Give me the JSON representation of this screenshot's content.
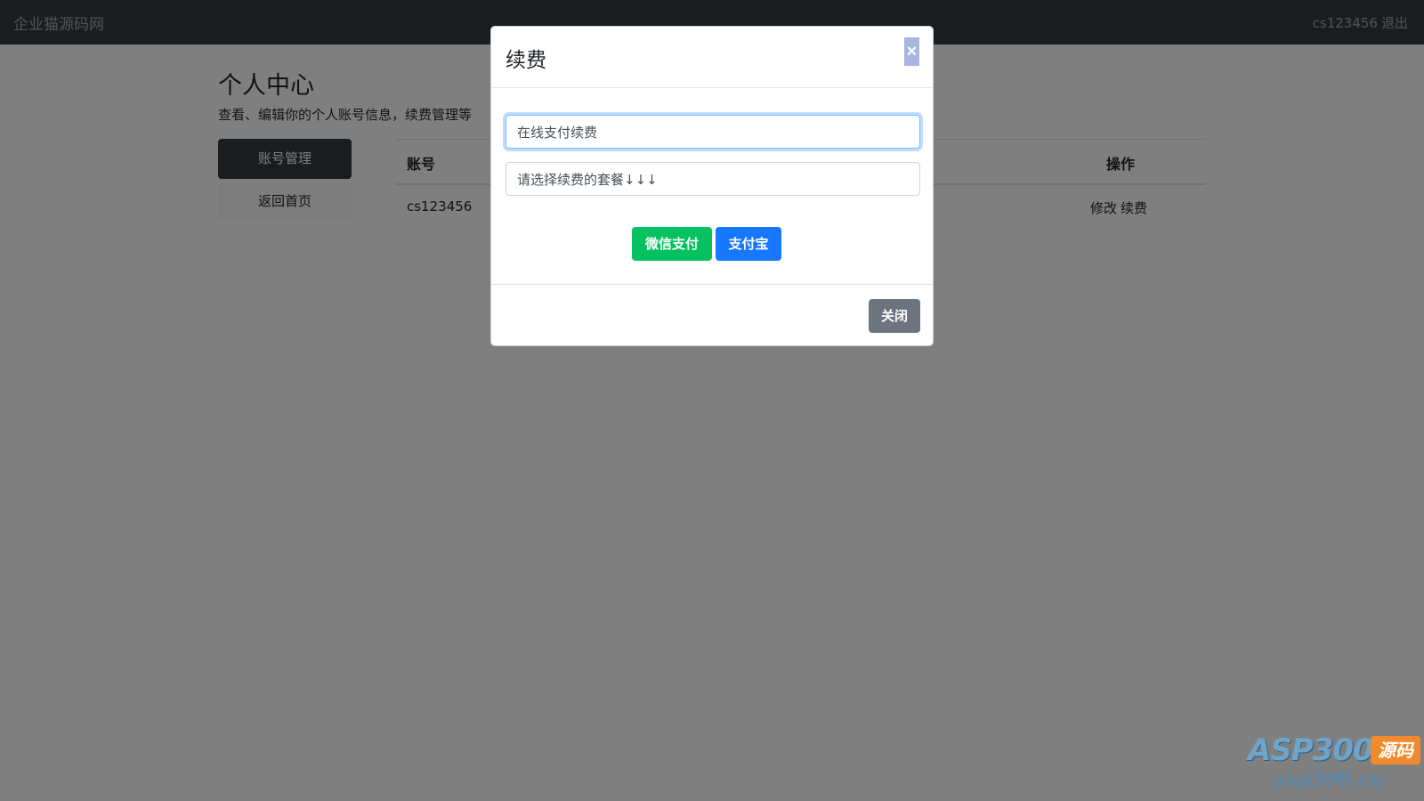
{
  "navbar": {
    "brand": "企业猫源码网",
    "username": "cs123456",
    "logout_label": "退出"
  },
  "page": {
    "title": "个人中心",
    "subtitle": "查看、编辑你的个人账号信息，续费管理等",
    "sidebar": [
      {
        "label": "账号管理",
        "active": true
      },
      {
        "label": "返回首页",
        "active": false
      }
    ],
    "table": {
      "headers": {
        "account": "账号",
        "actions": "操作"
      },
      "rows": [
        {
          "account": "cs123456",
          "edit_label": "修改",
          "renew_label": "续费"
        }
      ]
    }
  },
  "modal": {
    "title": "续费",
    "close_icon": "×",
    "payment_method_value": "在线支付续费",
    "package_select_value": "请选择续费的套餐↓↓↓",
    "wechat_pay_label": "微信支付",
    "alipay_label": "支付宝",
    "close_label": "关闭"
  },
  "watermark": {
    "logo_text": "ASP300",
    "badge_text": "源码",
    "domain": "asp300.cn"
  },
  "colors": {
    "navbar": "#343a40",
    "wechat": "#06c160",
    "alipay": "#1677ff",
    "close_button": "#6c757d",
    "backdrop": "rgba(0,0,0,0.5)"
  }
}
